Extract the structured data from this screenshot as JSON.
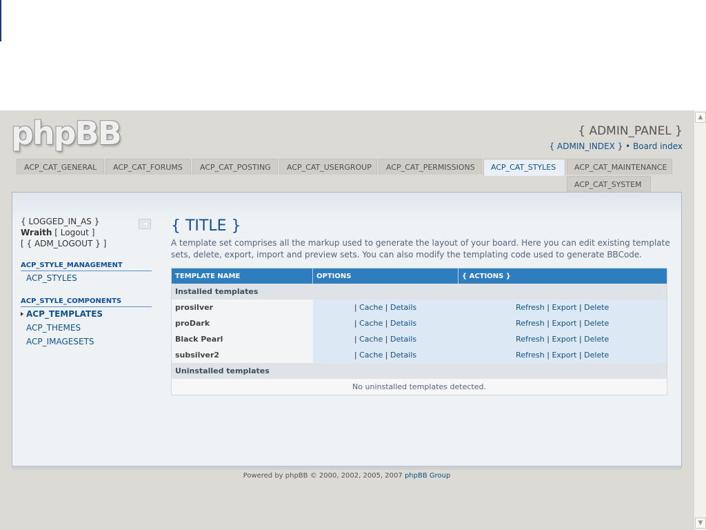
{
  "header": {
    "logo": "phpBB",
    "admin_panel": "{ ADMIN_PANEL }",
    "admin_index": "{ ADMIN_INDEX }",
    "bullet": "•",
    "board_index": "Board index"
  },
  "tabs": [
    {
      "label": "ACP_CAT_GENERAL"
    },
    {
      "label": "ACP_CAT_FORUMS"
    },
    {
      "label": "ACP_CAT_POSTING"
    },
    {
      "label": "ACP_CAT_USERGROUP"
    },
    {
      "label": "ACP_CAT_PERMISSIONS"
    },
    {
      "label": "ACP_CAT_STYLES"
    },
    {
      "label": "ACP_CAT_MAINTENANCE"
    },
    {
      "label": "ACP_CAT_SYSTEM"
    }
  ],
  "sidebar": {
    "logged_in_as": "{ LOGGED_IN_AS }",
    "username": "Wraith",
    "logout_open": "[",
    "logout": "Logout",
    "logout_close": "]",
    "adm_logout_open": "[",
    "adm_logout": "{ ADM_LOGOUT }",
    "adm_logout_close": "]",
    "section1_title": "ACP_STYLE_MANAGEMENT",
    "section1_items": [
      "ACP_STYLES"
    ],
    "section2_title": "ACP_STYLE_COMPONENTS",
    "section2_items": [
      "ACP_TEMPLATES",
      "ACP_THEMES",
      "ACP_IMAGESETS"
    ],
    "collapse_icon": "◄"
  },
  "main": {
    "title": "{ TITLE }",
    "description": "A template set comprises all the markup used to generate the layout of your board. Here you can edit existing template sets, delete, export, import and preview sets. You can also modify the templating code used to generate BBCode.",
    "table": {
      "headers": [
        "TEMPLATE NAME",
        "OPTIONS",
        "{ ACTIONS }"
      ],
      "installed_label": "Installed templates",
      "rows": [
        {
          "name": "prosilver",
          "cache": "Cache",
          "details": "Details",
          "refresh": "Refresh",
          "export": "Export",
          "delete": "Delete"
        },
        {
          "name": "proDark",
          "cache": "Cache",
          "details": "Details",
          "refresh": "Refresh",
          "export": "Export",
          "delete": "Delete"
        },
        {
          "name": "Black Pearl",
          "cache": "Cache",
          "details": "Details",
          "refresh": "Refresh",
          "export": "Export",
          "delete": "Delete"
        },
        {
          "name": "subsilver2",
          "cache": "Cache",
          "details": "Details",
          "refresh": "Refresh",
          "export": "Export",
          "delete": "Delete"
        }
      ],
      "uninstalled_label": "Uninstalled templates",
      "no_uninstalled": "No uninstalled templates detected."
    }
  },
  "footer": {
    "text": "Powered by phpBB © 2000, 2002, 2005, 2007",
    "link": "phpBB Group"
  }
}
